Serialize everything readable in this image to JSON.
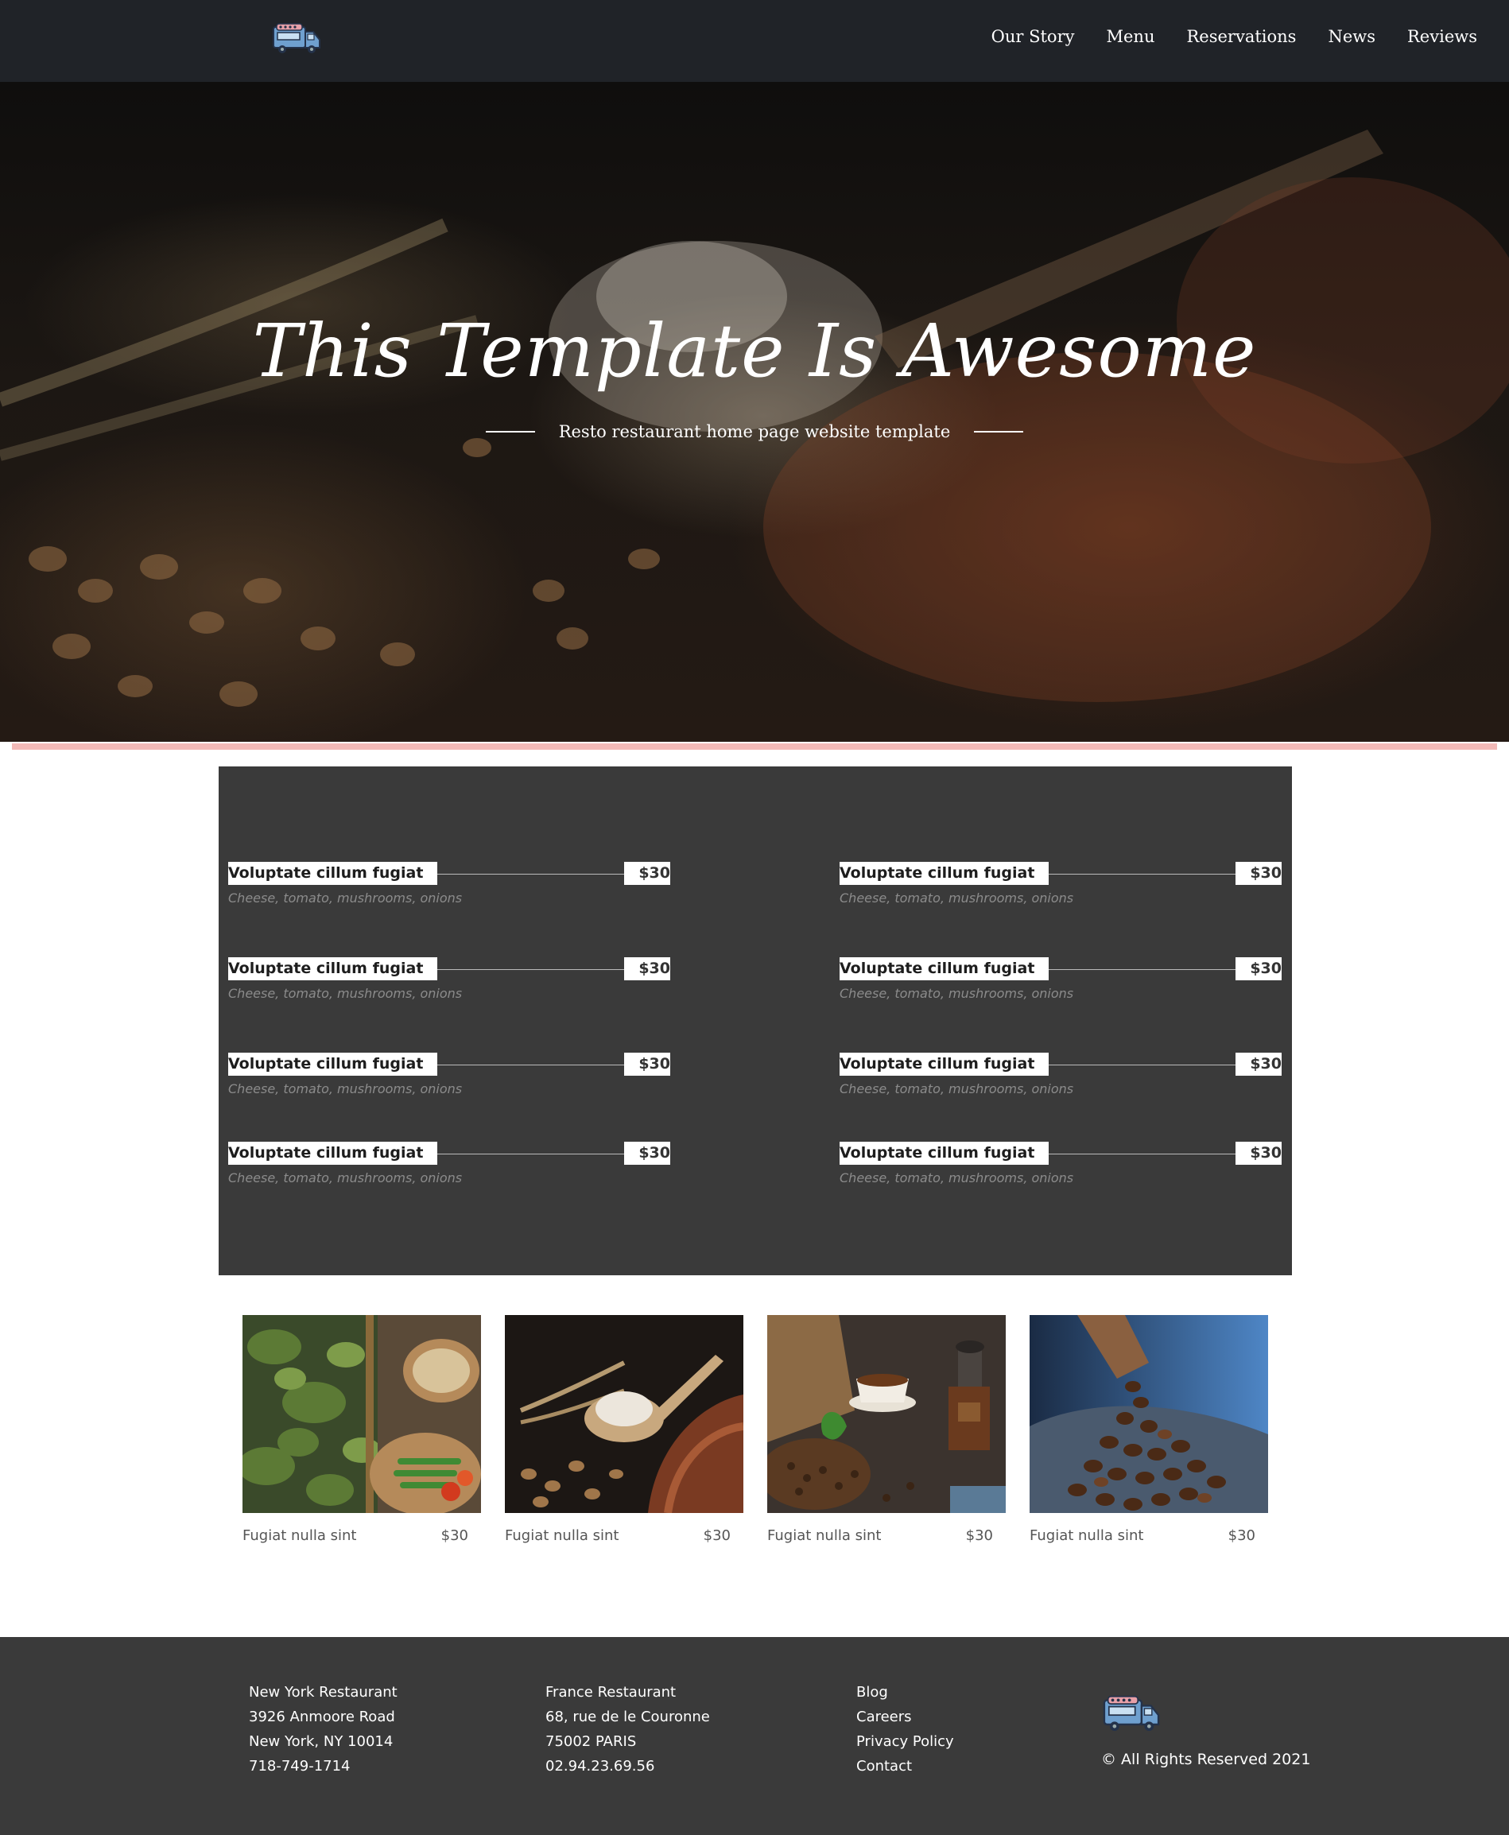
{
  "header": {
    "logo_icon": "food-truck-icon",
    "nav": [
      "Our Story",
      "Menu",
      "Reservations",
      "News",
      "Reviews"
    ]
  },
  "hero": {
    "title": "This Template Is Awesome",
    "subtitle": "Resto restaurant home page website template"
  },
  "menu": {
    "items": [
      {
        "name": "Voluptate cillum fugiat",
        "price": "$30",
        "desc": "Cheese, tomato, mushrooms, onions"
      },
      {
        "name": "Voluptate cillum fugiat",
        "price": "$30",
        "desc": "Cheese, tomato, mushrooms, onions"
      },
      {
        "name": "Voluptate cillum fugiat",
        "price": "$30",
        "desc": "Cheese, tomato, mushrooms, onions"
      },
      {
        "name": "Voluptate cillum fugiat",
        "price": "$30",
        "desc": "Cheese, tomato, mushrooms, onions"
      },
      {
        "name": "Voluptate cillum fugiat",
        "price": "$30",
        "desc": "Cheese, tomato, mushrooms, onions"
      },
      {
        "name": "Voluptate cillum fugiat",
        "price": "$30",
        "desc": "Cheese, tomato, mushrooms, onions"
      },
      {
        "name": "Voluptate cillum fugiat",
        "price": "$30",
        "desc": "Cheese, tomato, mushrooms, onions"
      },
      {
        "name": "Voluptate cillum fugiat",
        "price": "$30",
        "desc": "Cheese, tomato, mushrooms, onions"
      }
    ]
  },
  "cards": [
    {
      "name": "Fugiat nulla sint",
      "price": "$30",
      "image": "vegetables-photo"
    },
    {
      "name": "Fugiat nulla sint",
      "price": "$30",
      "image": "bread-flour-photo"
    },
    {
      "name": "Fugiat nulla sint",
      "price": "$30",
      "image": "coffee-cup-photo"
    },
    {
      "name": "Fugiat nulla sint",
      "price": "$30",
      "image": "coffee-beans-photo"
    }
  ],
  "footer": {
    "ny": [
      "New York Restaurant",
      "3926 Anmoore Road",
      "New York, NY 10014",
      "718-749-1714"
    ],
    "fr": [
      "France Restaurant",
      "68, rue de le Couronne",
      "75002 PARIS",
      "02.94.23.69.56"
    ],
    "links": [
      "Blog",
      "Careers",
      "Privacy Policy",
      "Contact"
    ],
    "copyright": "© All Rights Reserved 2021"
  },
  "colors": {
    "header_bg": "#202328",
    "accent_pink": "#f2b9b7",
    "panel_bg": "#3a3a3a",
    "footer_bg": "#3a3a3a"
  }
}
